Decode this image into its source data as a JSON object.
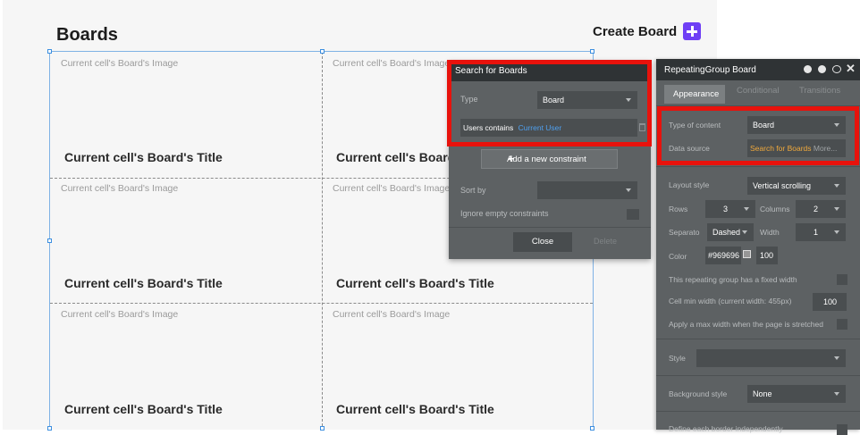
{
  "header": {
    "title": "Boards",
    "create_label": "Create Board"
  },
  "repeating_group": {
    "cells": [
      {
        "image": "Current cell's Board's Image",
        "title": "Current cell's Board's Title"
      },
      {
        "image": "Current cell's Board's Image",
        "title": "Current cell's Board's Title"
      },
      {
        "image": "Current cell's Board's Image",
        "title": "Current cell's Board's Title"
      },
      {
        "image": "Current cell's Board's Image",
        "title": "Current cell's Board's Title"
      },
      {
        "image": "Current cell's Board's Image",
        "title": "Current cell's Board's Title"
      },
      {
        "image": "Current cell's Board's Image",
        "title": "Current cell's Board's Title"
      }
    ]
  },
  "search_popup": {
    "title": "Search for Boards",
    "type_label": "Type",
    "type_value": "Board",
    "constraint_field": "Users contains",
    "constraint_value": "Current User",
    "add_constraint": "Add a new constraint",
    "sort_by_label": "Sort by",
    "ignore_empty_label": "Ignore empty constraints",
    "close_label": "Close",
    "delete_label": "Delete"
  },
  "property_panel": {
    "title": "RepeatingGroup Board",
    "tabs": [
      "Appearance",
      "Conditional",
      "Transitions"
    ],
    "type_of_content_label": "Type of content",
    "type_of_content_value": "Board",
    "data_source_label": "Data source",
    "data_source_value": "Search for Boards",
    "data_source_more": "More...",
    "layout_style_label": "Layout style",
    "layout_style_value": "Vertical scrolling",
    "rows_label": "Rows",
    "rows_value": "3",
    "columns_label": "Columns",
    "columns_value": "2",
    "separator_label": "Separato",
    "separator_value": "Dashed",
    "width_label": "Width",
    "width_value": "1",
    "color_label": "Color",
    "color_value": "#969696",
    "opacity_value": "100",
    "fixed_width_label": "This repeating group has a fixed width",
    "min_width_label": "Cell min width (current width: 455px)",
    "min_width_value": "100",
    "max_width_label": "Apply a max width when the page is stretched",
    "style_label": "Style",
    "background_style_label": "Background style",
    "background_style_value": "None",
    "define_borders_label": "Define each border independently"
  },
  "colors": {
    "accent_purple": "#6f3ff5",
    "highlight_red": "#e8120c",
    "panel_bg": "#5d6163",
    "panel_header": "#2f3335",
    "link_blue": "#4fa0ef",
    "source_orange": "#f0a93c",
    "selection_blue": "#7fb2e5"
  },
  "icons": [
    "plus-icon",
    "help-icon",
    "info-icon",
    "comment-icon",
    "close-icon",
    "trash-icon",
    "caret-down-icon"
  ]
}
